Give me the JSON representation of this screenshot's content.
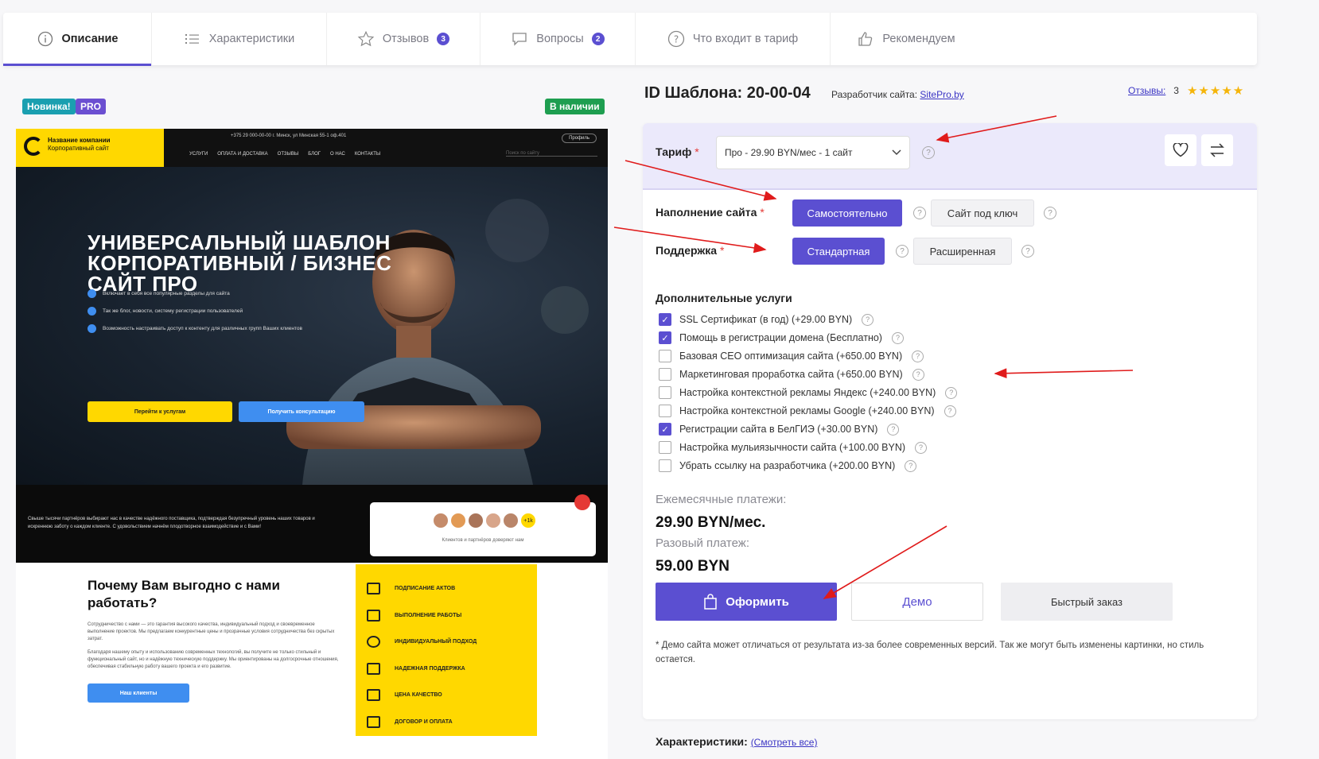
{
  "tabs": [
    {
      "label": "Описание",
      "icon": "info-icon",
      "active": true
    },
    {
      "label": "Характеристики",
      "icon": "list-icon"
    },
    {
      "label": "Отзывов",
      "icon": "star-icon",
      "badge": "3"
    },
    {
      "label": "Вопросы",
      "icon": "chat-icon",
      "badge": "2"
    },
    {
      "label": "Что входит в тариф",
      "icon": "question-icon"
    },
    {
      "label": "Рекомендуем",
      "icon": "thumbs-up-icon"
    }
  ],
  "badges": {
    "new": "Новинка!",
    "pro": "PRO",
    "stock": "В наличии"
  },
  "colors": {
    "accent": "#5b4fd1",
    "yellow": "#ffd800",
    "blue": "#3f8ef0",
    "new": "#1a9fb0",
    "pro": "#6b4fd1",
    "stock": "#1e9e50"
  },
  "preview": {
    "company_name": "Название компании",
    "company_sub": "Корпоративный сайт",
    "topline": "+375 29 000-00-00     г. Минск, ул Минская 55-1 оф.401",
    "profile": "Профиль",
    "nav": [
      "УСЛУГИ",
      "ОПЛАТА И ДОСТАВКА",
      "ОТЗЫВЫ",
      "БЛОГ",
      "О НАС",
      "КОНТАКТЫ"
    ],
    "search_placeholder": "Поиск по сайту",
    "hero_title_1": "УНИВЕРСАЛЬНЫЙ ШАБЛОН",
    "hero_title_2": "КОРПОРАТИВНЫЙ / БИЗНЕС",
    "hero_title_3": "САЙТ ПРО",
    "hero_checks": [
      "Включает в себя все популярные разделы для сайта",
      "Так же блог, новости, систему регистрации пользователей",
      "Возможность настраивать доступ к контенту для различных групп Ваших клиентов"
    ],
    "hero_btn_1": "Перейти к услугам",
    "hero_btn_2": "Получить консультацию",
    "band_text": "Свыше тысячи партнёров выбирают нас в качестве надёжного поставщика, подтверждая безупречный уровень наших товаров и искреннюю заботу о каждом клиенте. С удовольствием начнём плодотворное взаимодействие и с Вами!",
    "avatars_more": "+1k",
    "band_card_caption": "Клиентов и партнёров доверяют нам",
    "why_title": "Почему Вам выгодно с нами работать?",
    "why_p1": "Сотрудничество с нами — это гарантия высокого качества, индивидуальный подход и своевременное выполнение проектов. Мы предлагаем конкурентные цены и прозрачные условия сотрудничества без скрытых затрат.",
    "why_p2": "Благодаря нашему опыту и использованию современных технологий, вы получите не только стильный и функциональный сайт, но и надёжную техническую поддержку. Мы ориентированы на долгосрочные отношения, обеспечивая стабильную работу вашего проекта и его развитие.",
    "why_btn": "Наш клиенты",
    "yellow_items": [
      "ПОДПИСАНИЕ АКТОВ",
      "ВЫПОЛНЕНИЕ РАБОТЫ",
      "ИНДИВИДУАЛЬНЫЙ ПОДХОД",
      "НАДЕЖНАЯ ПОДДЕРЖКА",
      "ЦЕНА КАЧЕСТВО",
      "ДОГОВОР И ОПЛАТА"
    ]
  },
  "product": {
    "id_title": "ID Шаблона: 20-00-04",
    "dev_label": "Разработчик сайта:",
    "dev_link": "SitePro.by",
    "reviews_link": "Отзывы:",
    "reviews_count": "3",
    "stars": "★★★★★"
  },
  "form": {
    "tariff_label": "Тариф",
    "tariff_value": "Про - 29.90 BYN/мес - 1 сайт",
    "fill_label": "Наполнение сайта",
    "fill_options": [
      "Самостоятельно",
      "Сайт под ключ"
    ],
    "support_label": "Поддержка",
    "support_options": [
      "Стандартная",
      "Расширенная"
    ],
    "extra_title": "Дополнительные услуги",
    "extras": [
      {
        "label": "SSL Сертификат (в год) (+29.00 BYN)",
        "checked": true
      },
      {
        "label": "Помощь в регистрации домена (Бесплатно)",
        "checked": true
      },
      {
        "label": "Базовая СЕО оптимизация сайта (+650.00 BYN)",
        "checked": false
      },
      {
        "label": "Маркетинговая проработка сайта (+650.00 BYN)",
        "checked": false
      },
      {
        "label": "Настройка контекстной рекламы Яндекс (+240.00 BYN)",
        "checked": false
      },
      {
        "label": "Настройка контекстной рекламы Google (+240.00 BYN)",
        "checked": false
      },
      {
        "label": "Регистрации сайта в БелГИЭ (+30.00 BYN)",
        "checked": true
      },
      {
        "label": "Настройка мульиязычности сайта (+100.00 BYN)",
        "checked": false
      },
      {
        "label": "Убрать ссылку на разработчика (+200.00 BYN)",
        "checked": false
      }
    ],
    "monthly_label": "Ежемесячные платежи:",
    "monthly_value": "29.90 BYN/мес.",
    "once_label": "Разовый платеж:",
    "once_value": "59.00 BYN",
    "order_btn": "Оформить",
    "demo_btn": "Демо",
    "fast_btn": "Быстрый заказ",
    "note": "* Демо сайта может отличаться от результата из-за более современных версий. Так же могут быть изменены картинки, но стиль остается.",
    "chars_label": "Характеристики:",
    "chars_link": "(Смотреть все)"
  }
}
